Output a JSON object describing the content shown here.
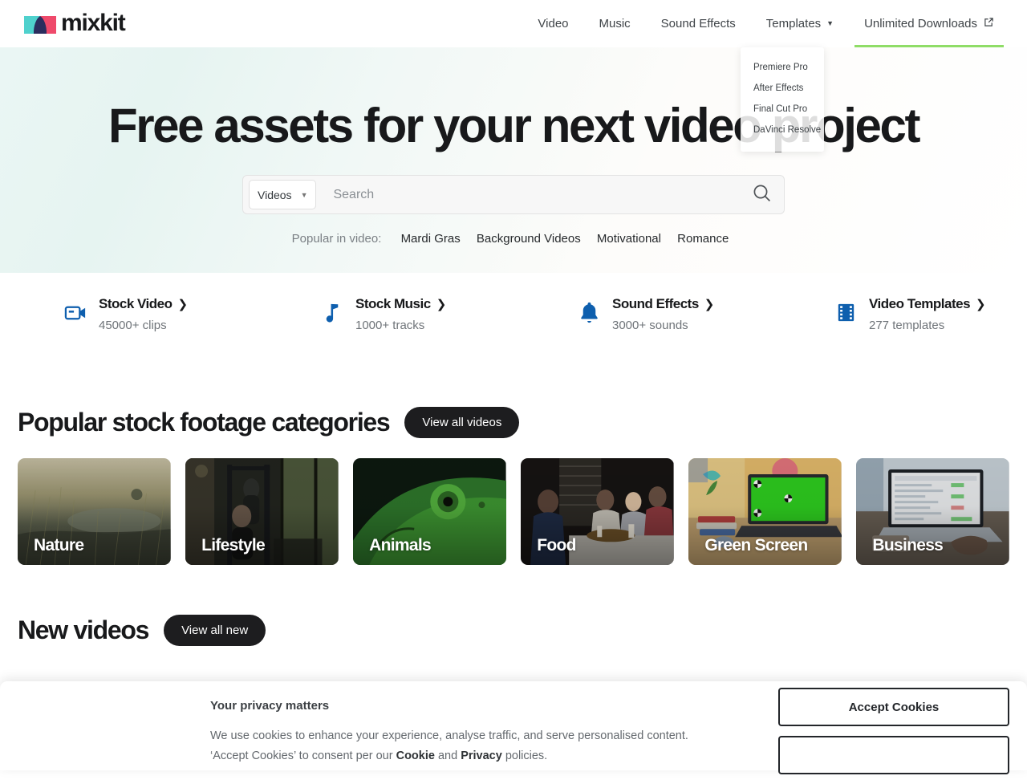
{
  "header": {
    "logo_text": "mixkit",
    "logo_colors": {
      "left": "#4fd1cd",
      "middle": "#2b2d5e",
      "right": "#ef4a6b"
    },
    "nav": [
      {
        "label": "Video",
        "icon": "",
        "active": false
      },
      {
        "label": "Music",
        "icon": "",
        "active": false
      },
      {
        "label": "Sound Effects",
        "icon": "",
        "active": false
      },
      {
        "label": "Templates",
        "icon": "chevron-down-icon",
        "active": false
      },
      {
        "label": "Unlimited Downloads",
        "icon": "external-link-icon",
        "active": true
      }
    ],
    "active_underline_color": "#8fdd67"
  },
  "dropdown": {
    "open": true,
    "items": [
      {
        "label": "Premiere Pro"
      },
      {
        "label": "After Effects"
      },
      {
        "label": "Final Cut Pro"
      },
      {
        "label": "DaVinci Resolve"
      }
    ]
  },
  "hero": {
    "title": "Free assets for your next video project",
    "search": {
      "type_label": "Videos",
      "placeholder": "Search",
      "value": "",
      "icon": "search-icon"
    },
    "popular_label": "Popular in video:",
    "popular_links": [
      "Mardi Gras",
      "Background Videos",
      "Motivational",
      "Romance"
    ]
  },
  "quick_links": [
    {
      "icon": "video-camera-icon",
      "title": "Stock Video",
      "count": "45000+ clips",
      "color": "#0e5fae"
    },
    {
      "icon": "music-note-icon",
      "title": "Stock Music",
      "count": "1000+ tracks",
      "color": "#0e5fae"
    },
    {
      "icon": "bell-icon",
      "title": "Sound Effects",
      "count": "3000+ sounds",
      "color": "#0e5fae"
    },
    {
      "icon": "film-strip-icon",
      "title": "Video Templates",
      "count": "277 templates",
      "color": "#0e5fae"
    }
  ],
  "categories_section": {
    "title": "Popular stock footage categories",
    "button": "View all videos",
    "cards": [
      {
        "label": "Nature"
      },
      {
        "label": "Lifestyle"
      },
      {
        "label": "Animals"
      },
      {
        "label": "Food"
      },
      {
        "label": "Green Screen"
      },
      {
        "label": "Business"
      }
    ]
  },
  "new_section": {
    "title": "New videos",
    "button": "View all new"
  },
  "cookie_banner": {
    "title": "Your privacy matters",
    "line1": "We use cookies to enhance your experience, analyse traffic, and serve personalised content.",
    "line2_pre": "‘Accept Cookies’ to consent per our ",
    "link1": "Cookie",
    "line2_mid": " and ",
    "link2": "Privacy",
    "line2_post": " policies.",
    "accept_label": "Accept Cookies"
  }
}
